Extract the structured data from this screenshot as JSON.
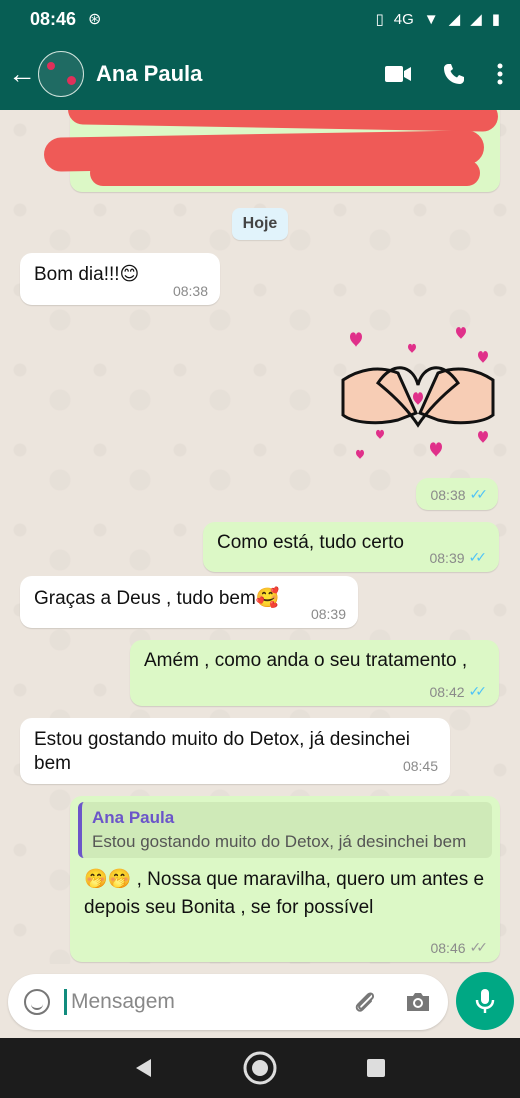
{
  "status": {
    "time": "08:46",
    "network": "4G"
  },
  "header": {
    "contact_name": "Ana Paula"
  },
  "date_divider": "Hoje",
  "messages": [
    {
      "text": "Bom dia!!!😊",
      "time": "08:38"
    },
    {
      "time": "08:38"
    },
    {
      "text": "Como está, tudo certo",
      "time": "08:39"
    },
    {
      "text": "Graças a Deus , tudo bem🥰",
      "time": "08:39"
    },
    {
      "text": "Amém , como anda o seu tratamento ,",
      "time": "08:42"
    },
    {
      "text": "Estou gostando muito do Detox, já desinchei bem",
      "time": "08:45"
    },
    {
      "quote_name": "Ana Paula",
      "quote_text": "Estou gostando muito do Detox, já desinchei bem",
      "text": "🤭🤭 , Nossa que maravilha, quero um antes e depois seu Bonita , se for possível",
      "time": "08:46"
    }
  ],
  "composer": {
    "placeholder": "Mensagem"
  },
  "colors": {
    "header": "#075e54",
    "outgoing": "#dcf8c6",
    "accent": "#00a884"
  }
}
